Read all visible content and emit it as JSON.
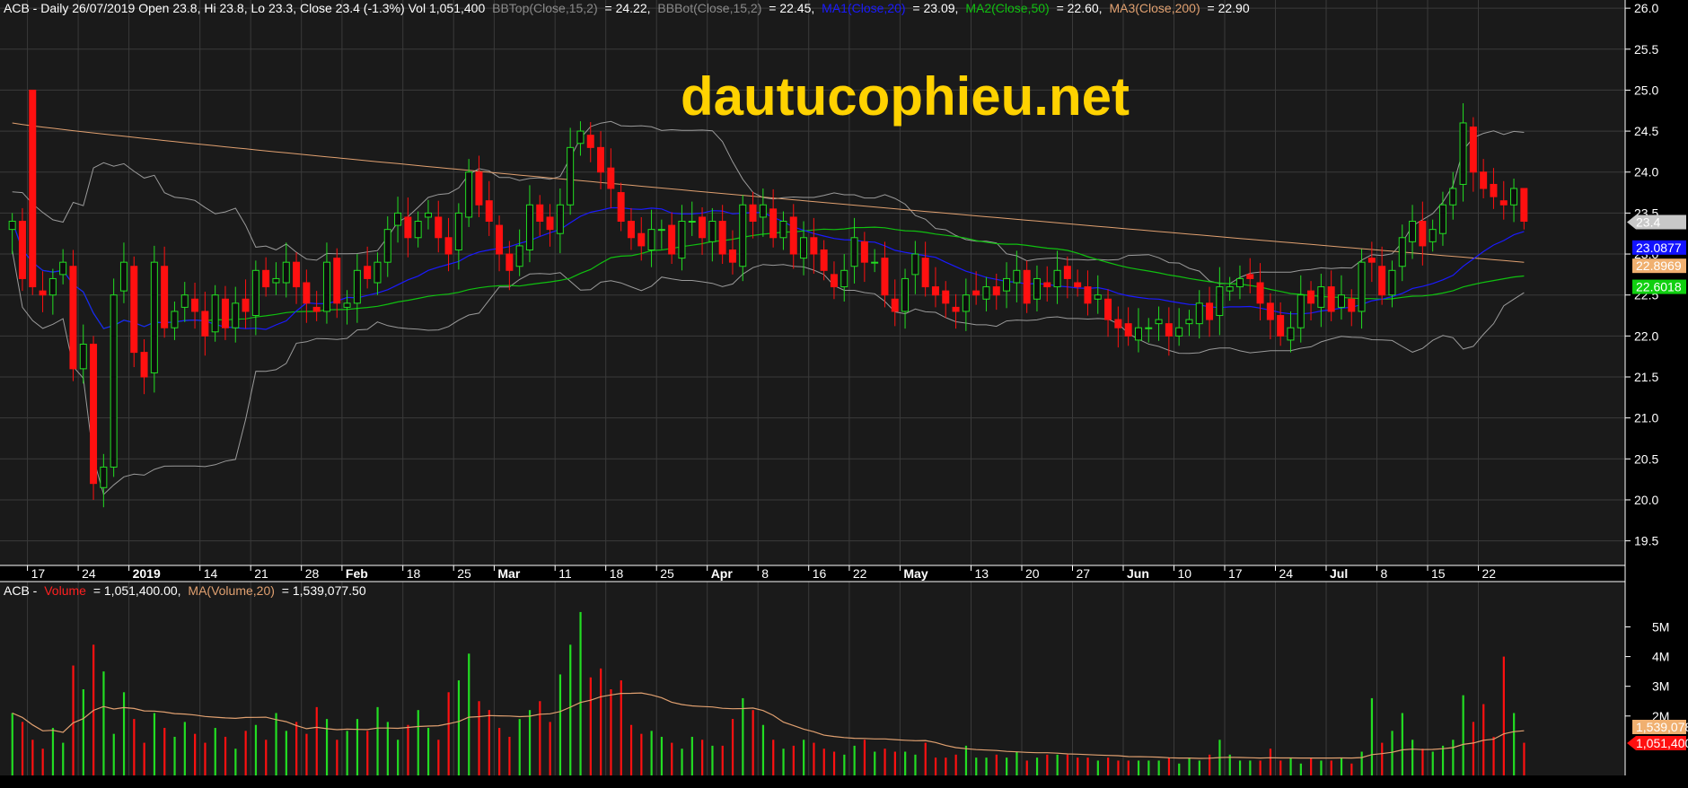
{
  "watermark": "dautucophieu.net",
  "price_header": {
    "prefix": "ACB - Daily 26/07/2019 Open 23.8, Hi 23.8, Lo 23.3, Close 23.4 (-1.3%) Vol 1,051,400",
    "bbtop_label": "BBTop(Close,15,2)",
    "bbtop_value": "= 24.22,",
    "bbbot_label": "BBBot(Close,15,2)",
    "bbbot_value": "= 22.45,",
    "ma1_label": "MA1(Close,20)",
    "ma1_value": "= 23.09,",
    "ma2_label": "MA2(Close,50)",
    "ma2_value": "= 22.60,",
    "ma3_label": "MA3(Close,200)",
    "ma3_value": "= 22.90"
  },
  "volume_header": {
    "prefix": "ACB -",
    "vol_label": "Volume",
    "vol_value": "= 1,051,400.00,",
    "ma_label": "MA(Volume,20)",
    "ma_value": "= 1,539,077.50"
  },
  "colors": {
    "up": "#22dd22",
    "down": "#ff1010",
    "bb": "#9a9a9a",
    "ma1": "#1a1aff",
    "ma2": "#10c010",
    "ma3": "#e0a070",
    "watermark": "#ffd200",
    "grid": "#3a3a3a"
  },
  "chart_data": [
    {
      "type": "candlestick",
      "ticker": "ACB",
      "ylim": [
        19.2,
        26.1
      ],
      "y_ticks": [
        "26.0",
        "25.5",
        "25.0",
        "24.5",
        "24.0",
        "23.5",
        "23.0",
        "22.5",
        "22.0",
        "21.5",
        "21.0",
        "20.5",
        "20.0",
        "19.5"
      ],
      "x_labels": [
        {
          "label": "17",
          "bold": false,
          "i": 2
        },
        {
          "label": "24",
          "bold": false,
          "i": 7
        },
        {
          "label": "2019",
          "bold": true,
          "i": 12
        },
        {
          "label": "14",
          "bold": false,
          "i": 19
        },
        {
          "label": "21",
          "bold": false,
          "i": 24
        },
        {
          "label": "28",
          "bold": false,
          "i": 29
        },
        {
          "label": "Feb",
          "bold": true,
          "i": 33
        },
        {
          "label": "18",
          "bold": false,
          "i": 39
        },
        {
          "label": "25",
          "bold": false,
          "i": 44
        },
        {
          "label": "Mar",
          "bold": true,
          "i": 48
        },
        {
          "label": "11",
          "bold": false,
          "i": 54
        },
        {
          "label": "18",
          "bold": false,
          "i": 59
        },
        {
          "label": "25",
          "bold": false,
          "i": 64
        },
        {
          "label": "Apr",
          "bold": true,
          "i": 69
        },
        {
          "label": "8",
          "bold": false,
          "i": 74
        },
        {
          "label": "16",
          "bold": false,
          "i": 79
        },
        {
          "label": "22",
          "bold": false,
          "i": 83
        },
        {
          "label": "May",
          "bold": true,
          "i": 88
        },
        {
          "label": "13",
          "bold": false,
          "i": 95
        },
        {
          "label": "20",
          "bold": false,
          "i": 100
        },
        {
          "label": "27",
          "bold": false,
          "i": 105
        },
        {
          "label": "Jun",
          "bold": true,
          "i": 110
        },
        {
          "label": "10",
          "bold": false,
          "i": 115
        },
        {
          "label": "17",
          "bold": false,
          "i": 120
        },
        {
          "label": "24",
          "bold": false,
          "i": 125
        },
        {
          "label": "Jul",
          "bold": true,
          "i": 130
        },
        {
          "label": "8",
          "bold": false,
          "i": 135
        },
        {
          "label": "15",
          "bold": false,
          "i": 140
        },
        {
          "label": "22",
          "bold": false,
          "i": 145
        }
      ],
      "closes": [
        23.4,
        22.7,
        22.6,
        22.5,
        22.7,
        22.9,
        21.6,
        21.9,
        20.2,
        20.4,
        22.5,
        22.9,
        21.8,
        21.5,
        22.9,
        22.1,
        22.3,
        22.5,
        22.3,
        22.0,
        22.5,
        22.1,
        22.4,
        22.3,
        22.8,
        22.6,
        22.7,
        22.9,
        22.6,
        22.4,
        22.3,
        22.9,
        22.4,
        22.4,
        22.8,
        22.7,
        22.9,
        23.3,
        23.5,
        23.2,
        23.4,
        23.5,
        23.2,
        23.0,
        23.5,
        24.0,
        23.6,
        23.4,
        23.0,
        22.8,
        23.1,
        23.6,
        23.4,
        23.3,
        23.6,
        24.3,
        24.5,
        24.3,
        24.0,
        23.8,
        23.4,
        23.2,
        23.1,
        23.3,
        23.3,
        23.0,
        23.4,
        23.4,
        23.2,
        23.4,
        23.0,
        22.9,
        23.6,
        23.4,
        23.6,
        23.2,
        23.4,
        23.0,
        23.2,
        23.0,
        22.8,
        22.6,
        22.8,
        23.2,
        22.9,
        22.9,
        22.5,
        22.3,
        22.7,
        23.0,
        22.6,
        22.5,
        22.4,
        22.3,
        22.5,
        22.5,
        22.6,
        22.5,
        22.7,
        22.8,
        22.4,
        22.7,
        22.6,
        22.8,
        22.7,
        22.6,
        22.4,
        22.5,
        22.2,
        22.1,
        22.0,
        22.1,
        22.1,
        22.2,
        22.0,
        22.1,
        22.2,
        22.4,
        22.2,
        22.6,
        22.6,
        22.7,
        22.7,
        22.4,
        22.2,
        22.0,
        22.1,
        22.5,
        22.4,
        22.6,
        22.3,
        22.5,
        22.3,
        22.9,
        22.9,
        22.5,
        22.8,
        23.2,
        23.4,
        23.1,
        23.3,
        23.6,
        23.8,
        24.6,
        24.0,
        23.8,
        23.7,
        23.6,
        23.8,
        23.4
      ],
      "ohlc_sample": [
        {
          "i": 0,
          "o": 23.3,
          "h": 23.5,
          "l": 23.0,
          "c": 23.4
        },
        {
          "i": 2,
          "o": 25.0,
          "h": 25.0,
          "l": 22.5,
          "c": 22.6
        },
        {
          "i": 8,
          "o": 21.9,
          "h": 22.0,
          "l": 20.0,
          "c": 20.2
        },
        {
          "i": 149,
          "o": 23.8,
          "h": 23.8,
          "l": 23.3,
          "c": 23.4
        }
      ],
      "last_value_labels": {
        "close": "23.4",
        "ma1": "23.0877",
        "ma3": "22.8969",
        "ma2": "22.6018"
      }
    },
    {
      "type": "bar",
      "title": "Volume",
      "y_ticks": [
        "5M",
        "4M",
        "3M",
        "2M"
      ],
      "ylim": [
        0,
        5800000
      ],
      "volumes_m": [
        2.1,
        1.8,
        1.2,
        0.9,
        1.6,
        1.1,
        3.7,
        2.9,
        4.4,
        3.5,
        1.4,
        2.8,
        1.9,
        1.1,
        2.1,
        1.6,
        1.3,
        1.8,
        1.4,
        1.1,
        1.6,
        1.3,
        0.9,
        1.5,
        1.7,
        1.2,
        2.1,
        1.5,
        1.8,
        1.4,
        2.3,
        1.9,
        1.2,
        1.5,
        1.9,
        1.5,
        2.3,
        1.8,
        1.2,
        1.7,
        2.2,
        1.6,
        1.2,
        2.8,
        3.2,
        4.1,
        2.5,
        2.2,
        1.6,
        1.3,
        1.9,
        2.2,
        2.5,
        1.8,
        3.4,
        4.4,
        5.5,
        3.3,
        3.6,
        2.9,
        3.2,
        1.7,
        1.4,
        1.5,
        1.3,
        1.1,
        0.9,
        1.3,
        1.2,
        1.0,
        1.0,
        1.9,
        2.6,
        2.2,
        1.7,
        1.2,
        0.9,
        1.0,
        1.2,
        1.1,
        0.9,
        0.8,
        0.7,
        1.0,
        1.2,
        0.8,
        0.9,
        0.8,
        0.8,
        0.7,
        1.1,
        0.6,
        0.6,
        0.7,
        1.0,
        0.6,
        0.6,
        0.7,
        0.6,
        0.8,
        0.5,
        0.6,
        0.7,
        0.7,
        0.7,
        0.6,
        0.6,
        0.5,
        0.6,
        0.5,
        0.5,
        0.5,
        0.5,
        0.5,
        0.6,
        0.4,
        0.6,
        0.5,
        0.7,
        1.2,
        0.7,
        0.5,
        0.5,
        0.5,
        0.9,
        0.5,
        0.6,
        0.4,
        0.6,
        0.5,
        0.5,
        0.6,
        0.4,
        0.8,
        2.6,
        1.1,
        1.5,
        2.1,
        1.2,
        0.9,
        0.8,
        1.0,
        1.2,
        2.7,
        1.8,
        2.4,
        1.3,
        4.0,
        2.1,
        1.1
      ],
      "last_value_labels": {
        "ma": "1,539,078",
        "volume": "1,051,400"
      }
    }
  ]
}
